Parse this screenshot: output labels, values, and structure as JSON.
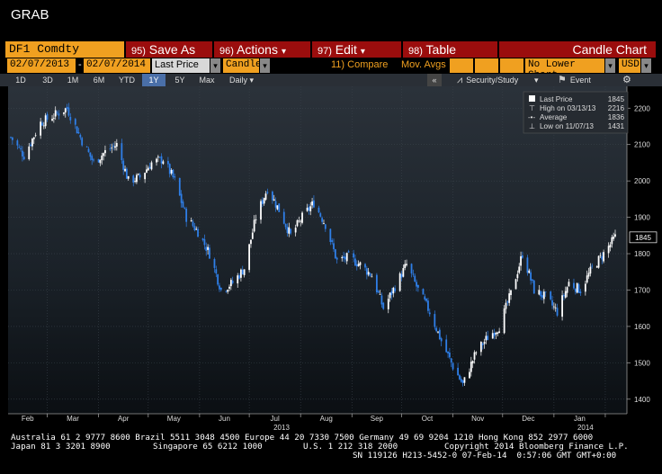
{
  "window": {
    "title": "GRAB"
  },
  "command_row": {
    "ticker": "DF1 Comdty",
    "buttons": [
      {
        "num": "95)",
        "label": "Save As",
        "caret": false
      },
      {
        "num": "96)",
        "label": "Actions",
        "caret": true
      },
      {
        "num": "97)",
        "label": "Edit",
        "caret": true
      },
      {
        "num": "98)",
        "label": "Table",
        "caret": false
      }
    ],
    "chart_type_label": "Candle Chart"
  },
  "options_row": {
    "start_date": "02/07/2013",
    "end_date": "02/07/2014",
    "separator": "-",
    "field": "Last Price",
    "style": "Candle",
    "compare": "11) Compare",
    "mov_avgs": "Mov. Avgs",
    "lower_chart": "No Lower Chart",
    "currency": "USD"
  },
  "range_row": {
    "ranges": [
      "1D",
      "3D",
      "1M",
      "6M",
      "YTD",
      "1Y",
      "5Y",
      "Max"
    ],
    "selected_range": "1Y",
    "frequency": "Daily",
    "collapse": "«",
    "security_study": "Security/Study",
    "event": "Event"
  },
  "legend": {
    "last_price_label": "Last Price",
    "last_price_value": "1845",
    "high_label": "High on 03/13/13",
    "high_value": "2216",
    "average_label": "Average",
    "average_value": "1836",
    "low_label": "Low on 11/07/13",
    "low_value": "1431"
  },
  "chart_data": {
    "type": "candlestick",
    "title": "",
    "xlabel": "",
    "ylabel": "",
    "ylim": [
      1360,
      2260
    ],
    "y_ticks": [
      1400,
      1500,
      1600,
      1700,
      1800,
      1900,
      2000,
      2100,
      2200
    ],
    "x_tick_labels": [
      "Feb",
      "Mar",
      "Apr",
      "May",
      "Jun",
      "Jul",
      "Aug",
      "Sep",
      "Oct",
      "Nov",
      "Dec",
      "Jan"
    ],
    "year_labels": [
      "2013",
      "2014"
    ],
    "last_value_tag": "1845",
    "up_color": "#ffffff",
    "down_color": "#2f7fe8",
    "series": [
      {
        "name": "DF1 Comdty",
        "close_path": [
          [
            "2013-02-07",
            2120
          ],
          [
            "2013-02-15",
            2070
          ],
          [
            "2013-02-25",
            2160
          ],
          [
            "2013-03-05",
            2180
          ],
          [
            "2013-03-13",
            2200
          ],
          [
            "2013-03-22",
            2110
          ],
          [
            "2013-03-29",
            2050
          ],
          [
            "2013-04-05",
            2080
          ],
          [
            "2013-04-12",
            2100
          ],
          [
            "2013-04-19",
            2000
          ],
          [
            "2013-04-26",
            2010
          ],
          [
            "2013-05-03",
            2050
          ],
          [
            "2013-05-10",
            2060
          ],
          [
            "2013-05-17",
            2000
          ],
          [
            "2013-05-24",
            1900
          ],
          [
            "2013-05-31",
            1860
          ],
          [
            "2013-06-07",
            1800
          ],
          [
            "2013-06-14",
            1700
          ],
          [
            "2013-06-21",
            1720
          ],
          [
            "2013-06-28",
            1760
          ],
          [
            "2013-07-05",
            1900
          ],
          [
            "2013-07-12",
            1980
          ],
          [
            "2013-07-19",
            1920
          ],
          [
            "2013-07-26",
            1850
          ],
          [
            "2013-08-02",
            1900
          ],
          [
            "2013-08-09",
            1940
          ],
          [
            "2013-08-16",
            1880
          ],
          [
            "2013-08-23",
            1780
          ],
          [
            "2013-08-30",
            1790
          ],
          [
            "2013-09-06",
            1770
          ],
          [
            "2013-09-13",
            1740
          ],
          [
            "2013-09-20",
            1650
          ],
          [
            "2013-09-27",
            1710
          ],
          [
            "2013-10-04",
            1770
          ],
          [
            "2013-10-11",
            1700
          ],
          [
            "2013-10-18",
            1640
          ],
          [
            "2013-10-25",
            1560
          ],
          [
            "2013-11-01",
            1490
          ],
          [
            "2013-11-07",
            1440
          ],
          [
            "2013-11-15",
            1530
          ],
          [
            "2013-11-22",
            1570
          ],
          [
            "2013-11-29",
            1600
          ],
          [
            "2013-12-06",
            1690
          ],
          [
            "2013-12-13",
            1800
          ],
          [
            "2013-12-20",
            1700
          ],
          [
            "2013-12-27",
            1680
          ],
          [
            "2014-01-03",
            1640
          ],
          [
            "2014-01-10",
            1720
          ],
          [
            "2014-01-17",
            1700
          ],
          [
            "2014-01-24",
            1760
          ],
          [
            "2014-01-31",
            1800
          ],
          [
            "2014-02-07",
            1845
          ]
        ]
      }
    ]
  },
  "footer": {
    "line1": "Australia 61 2 9777 8600 Brazil 5511 3048 4500 Europe 44 20 7330 7500 Germany 49 69 9204 1210 Hong Kong 852 2977 6000",
    "line2a": "Japan 81 3 3201 8900",
    "line2b": "Singapore 65 6212 1000",
    "line2c": "U.S. 1 212 318 2000",
    "line2d": "Copyright 2014 Bloomberg Finance L.P.",
    "line3": "SN 119126 H213-5452-0 07-Feb-14  0:57:06 GMT GMT+0:00"
  }
}
